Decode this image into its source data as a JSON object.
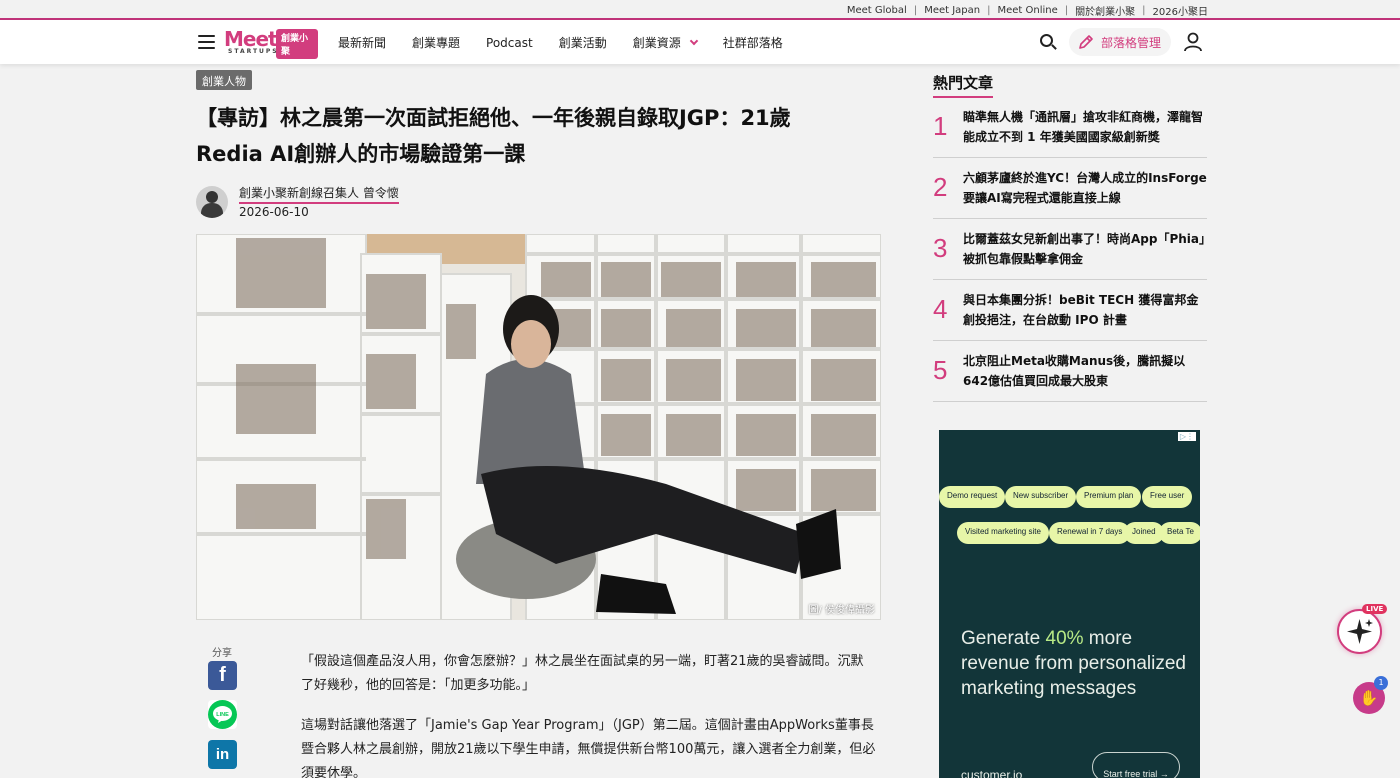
{
  "utility_links": [
    "Meet Global",
    "Meet Japan",
    "Meet Online",
    "關於創業小聚",
    "2026小聚日"
  ],
  "logo": {
    "wordmark": "Meet",
    "tag": "創業小聚",
    "sub": "STARTUPS"
  },
  "nav": {
    "items": [
      "最新新聞",
      "創業專題",
      "Podcast",
      "創業活動",
      "創業資源",
      "社群部落格"
    ],
    "blog_manage": "部落格管理"
  },
  "article": {
    "category": "創業人物",
    "title_line1": "【專訪】林之晨第一次面試拒絕他、一年後親自錄取JGP：21歲",
    "title_line2": "Redia AI創辦人的市場驗證第一課",
    "author": "創業小聚新創線召集人 曾令懷",
    "date": "2026-06-10",
    "photo_credit": "圖/ 侯俊偉攝影",
    "share_label": "分享",
    "paragraph1": "「假設這個產品沒人用，你會怎麼辦？」林之晨坐在面試桌的另一端，盯著21歲的吳睿誠問。沉默了好幾秒，他的回答是：「加更多功能。」",
    "paragraph2": "這場對話讓他落選了「Jamie's Gap Year Program」（JGP）第二屆。這個計畫由AppWorks董事長暨合夥人林之晨創辦，開放21歲以下學生申請，無償提供新台幣100萬元，讓入選者全力創業，但必須要休學。"
  },
  "sidebar": {
    "title": "熱門文章",
    "items": [
      {
        "num": "1",
        "text": "瞄準無人機「通訊層」搶攻非紅商機，澤龍智能成立不到 1 年獲美國國家級創新獎"
      },
      {
        "num": "2",
        "text": "六顧茅廬終於進YC！台灣人成立的InsForge要讓AI寫完程式還能直接上線"
      },
      {
        "num": "3",
        "text": "比爾蓋茲女兒新創出事了！時尚App「Phia」被抓包靠假點擊拿佣金"
      },
      {
        "num": "4",
        "text": "與日本集團分拆！beBit TECH 獲得富邦金創投挹注，在台啟動 IPO 計畫"
      },
      {
        "num": "5",
        "text": "北京阻止Meta收購Manus後，騰訊擬以642億估值買回成最大股東"
      }
    ]
  },
  "ad": {
    "chips_row1": [
      "Demo request",
      "New subscriber",
      "Premium plan",
      "Free user"
    ],
    "chips_row2": [
      "Visited marketing site",
      "Renewal in 7 days",
      "Joined",
      "Beta Te"
    ],
    "headline_pre": "Generate ",
    "headline_highlight": "40%",
    "headline_post": " more revenue from personalized marketing messages",
    "brand": "customer.io",
    "cta": "Start free trial →"
  },
  "widgets": {
    "live": "LIVE",
    "notif_count": "1"
  },
  "colors": {
    "accent": "#d23d7e",
    "ad_bg": "#123539",
    "chip": "#e7f6a8"
  }
}
